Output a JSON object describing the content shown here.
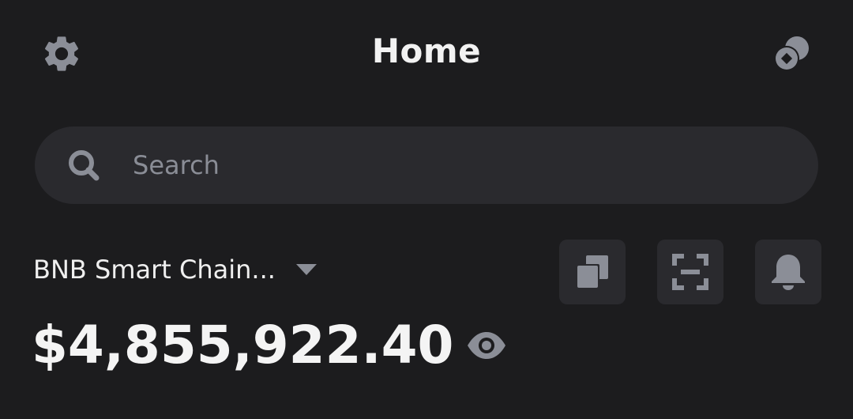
{
  "header": {
    "title": "Home",
    "settings_icon": "gear-icon",
    "account_icon": "coins-icon"
  },
  "search": {
    "placeholder": "Search",
    "value": ""
  },
  "wallet": {
    "network": "BNB Smart Chain...",
    "balance": "$4,855,922.40"
  },
  "actions": [
    {
      "icon": "copy-icon"
    },
    {
      "icon": "scan-icon"
    },
    {
      "icon": "bell-icon"
    }
  ],
  "colors": {
    "background": "#1c1c1e",
    "surface": "#2a2a2e",
    "icon": "#8b8e97",
    "text": "#f2f2f2",
    "placeholder": "#8a8d96"
  }
}
